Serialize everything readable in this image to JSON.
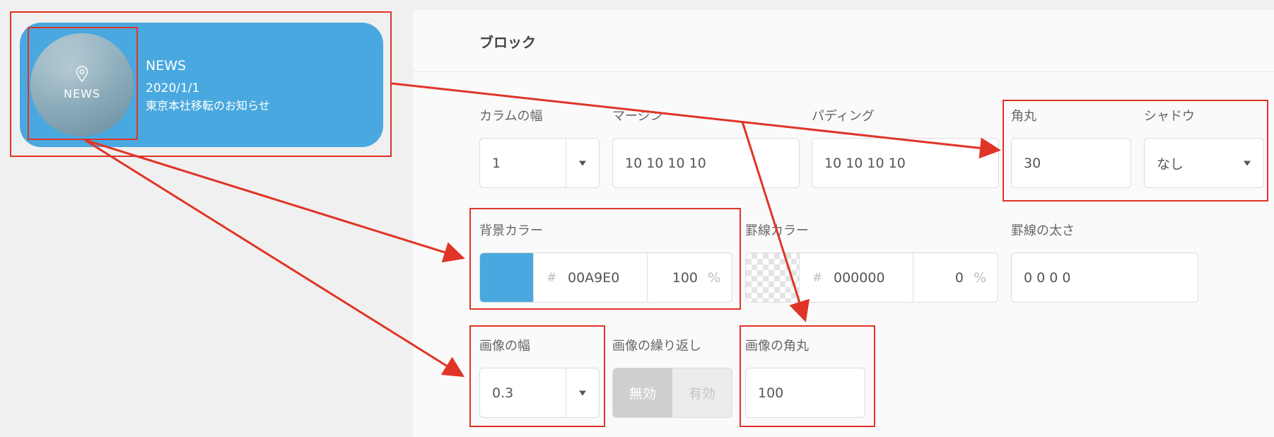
{
  "preview": {
    "thumb_label": "NEWS",
    "title": "NEWS",
    "date": "2020/1/1",
    "text": "東京本社移転のお知らせ"
  },
  "panel": {
    "title": "ブロック",
    "column_width": {
      "label": "カラムの幅",
      "value": "1"
    },
    "margin": {
      "label": "マージン",
      "value": "10 10 10 10"
    },
    "padding": {
      "label": "パディング",
      "value": "10 10 10 10"
    },
    "corner_radius": {
      "label": "角丸",
      "value": "30"
    },
    "shadow": {
      "label": "シャドウ",
      "value": "なし"
    },
    "background_color": {
      "label": "背景カラー",
      "hash": "#",
      "hex": "00A9E0",
      "opacity": "100",
      "unit": "%",
      "swatch_color": "#49a8df"
    },
    "border_color": {
      "label": "罫線カラー",
      "hash": "#",
      "hex": "000000",
      "opacity": "0",
      "unit": "%"
    },
    "border_width": {
      "label": "罫線の太さ",
      "value": "0 0 0 0"
    },
    "image_width": {
      "label": "画像の幅",
      "value": "0.3"
    },
    "image_repeat": {
      "label": "画像の繰り返し",
      "off": "無効",
      "on": "有効"
    },
    "image_radius": {
      "label": "画像の角丸",
      "value": "100"
    }
  },
  "colors": {
    "card_bg": "#49a8df",
    "annotation": "#e03427"
  }
}
